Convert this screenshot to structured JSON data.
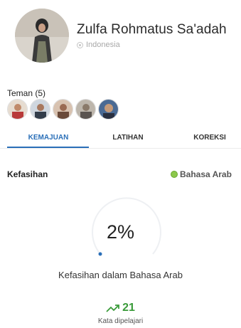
{
  "profile": {
    "name": "Zulfa Rohmatus Sa'adah",
    "location": "Indonesia"
  },
  "friends": {
    "title": "Teman (5)",
    "count": 5
  },
  "tabs": [
    {
      "label": "KEMAJUAN",
      "active": true
    },
    {
      "label": "LATIHAN",
      "active": false
    },
    {
      "label": "KOREKSI",
      "active": false
    }
  ],
  "progress": {
    "label": "Kefasihan",
    "language": "Bahasa Arab",
    "percent_label": "2%",
    "percent_value": 2,
    "description": "Kefasihan dalam Bahasa Arab",
    "words_learned": "21",
    "words_label": "Kata dipelajari"
  },
  "colors": {
    "accent": "#2a6fb8",
    "success": "#3a9b3a",
    "language_dot": "#8cc84b"
  }
}
